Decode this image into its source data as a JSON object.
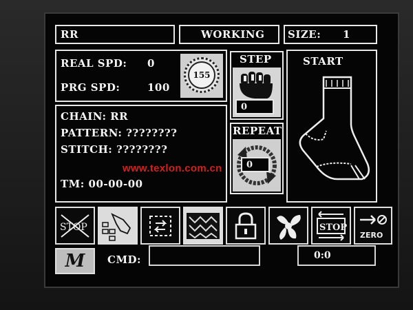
{
  "header": {
    "chain_short": "RR",
    "status": "WORKING",
    "size_label": "SIZE:",
    "size_value": "1"
  },
  "speed": {
    "real_label": "REAL SPD:",
    "real_value": "0",
    "prg_label": "PRG SPD:",
    "prg_value": "100",
    "dial_value": "155"
  },
  "step": {
    "label": "STEP",
    "value": "0"
  },
  "repeat": {
    "label": "REPEAT",
    "value": "0"
  },
  "start": {
    "label": "START"
  },
  "info": {
    "chain": "CHAIN: RR",
    "pattern": "PATTERN: ????????",
    "stitch": "STITCH: ????????",
    "tm": "TM:  00-00-00"
  },
  "toolbar": {
    "stop_text": "STOP",
    "stop2_text": "STOP",
    "zero_text": "ZERO"
  },
  "footer": {
    "menu_letter": "M",
    "cmd_label": "CMD:",
    "cmd_value": "",
    "counter": "0:0"
  },
  "watermark": "www.texlon.com.cn",
  "icons": [
    "stop-crossed-icon",
    "hand-menu-icon",
    "cycle-arrows-icon",
    "stitch-pattern-icon",
    "padlock-icon",
    "fan-icon",
    "stop-arrows-icon",
    "arrow-zero-icon",
    "fist-icon",
    "sock-icon"
  ]
}
